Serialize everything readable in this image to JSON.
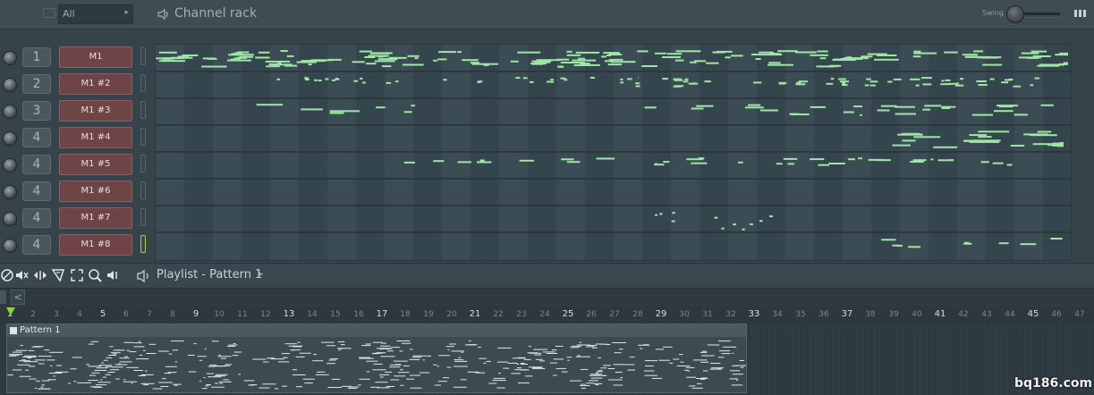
{
  "channel_rack": {
    "filter": "All",
    "title": "Channel rack",
    "swing_label": "Swing"
  },
  "channels": [
    {
      "number": "1",
      "name": "M1"
    },
    {
      "number": "2",
      "name": "M1 #2"
    },
    {
      "number": "3",
      "name": "M1 #3"
    },
    {
      "number": "4",
      "name": "M1 #4"
    },
    {
      "number": "4",
      "name": "M1 #5"
    },
    {
      "number": "4",
      "name": "M1 #6"
    },
    {
      "number": "4",
      "name": "M1 #7"
    },
    {
      "number": "4",
      "name": "M1 #8"
    }
  ],
  "playlist": {
    "title": "Playlist - Pattern 1",
    "pattern_clip_label": "Pattern 1"
  },
  "ruler": [
    "1",
    "2",
    "3",
    "4",
    "5",
    "6",
    "7",
    "8",
    "9",
    "10",
    "11",
    "12",
    "13",
    "14",
    "15",
    "16",
    "17",
    "18",
    "19",
    "20",
    "21",
    "22",
    "23",
    "24",
    "25",
    "26",
    "27",
    "28",
    "29",
    "30",
    "31",
    "32",
    "33",
    "34",
    "35",
    "36",
    "37",
    "38",
    "39",
    "40",
    "41",
    "42",
    "43",
    "44",
    "45",
    "46",
    "47"
  ],
  "icons": {
    "folder": "folder-icon",
    "speaker": "speaker-icon",
    "swing_knob": "knob-icon",
    "rack_menu": "bars-menu-icon"
  },
  "colors": {
    "note": "#9fe6a6",
    "channel_button": "#6e4447",
    "selected_channel": "#a6d16a",
    "playhead": "#8bd43a"
  },
  "watermark": "bq186.com"
}
